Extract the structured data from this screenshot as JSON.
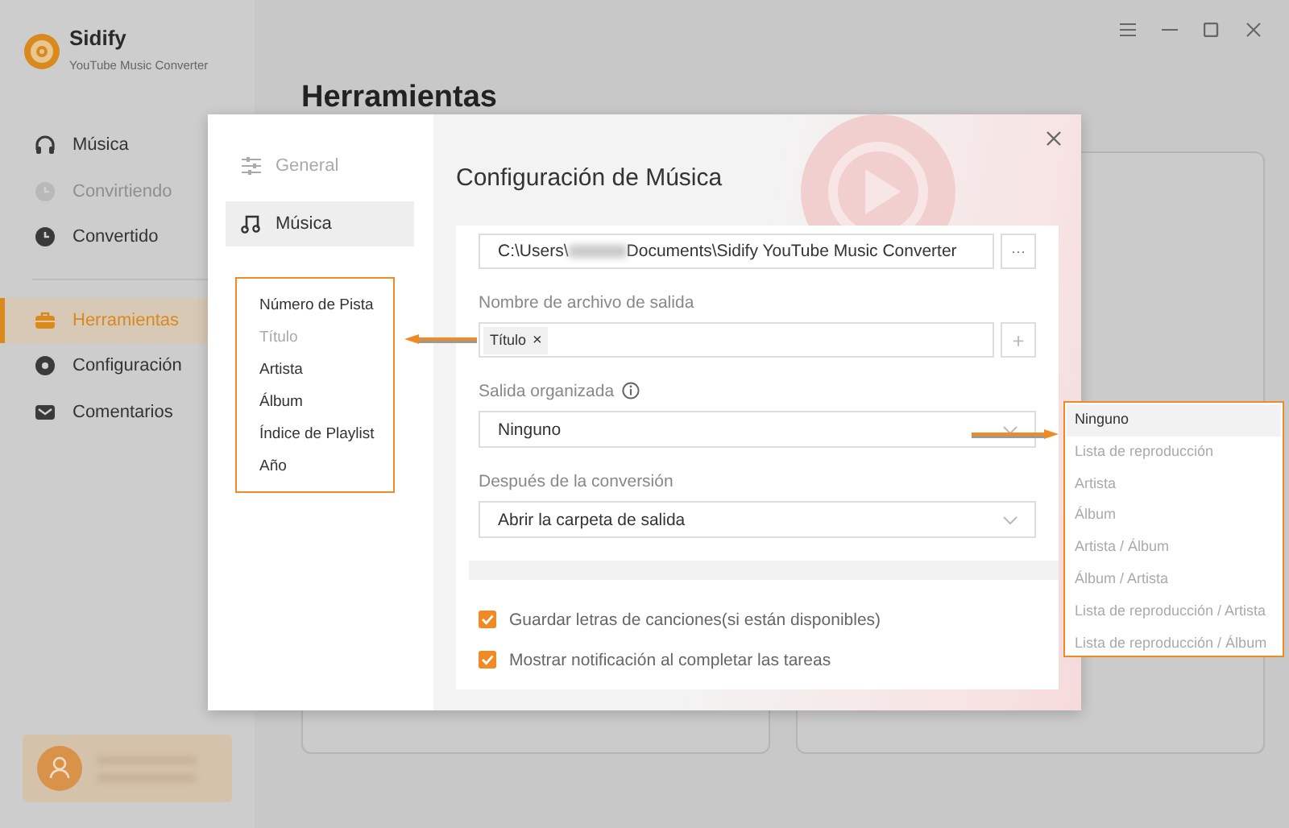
{
  "app": {
    "name": "Sidify",
    "subtitle": "YouTube Music Converter"
  },
  "sidebar": {
    "items": [
      {
        "label": "Música",
        "selected": false,
        "disabled": false
      },
      {
        "label": "Convirtiendo",
        "selected": false,
        "disabled": true
      },
      {
        "label": "Convertido",
        "selected": false,
        "disabled": false
      },
      {
        "label": "Herramientas",
        "selected": true,
        "disabled": false
      },
      {
        "label": "Configuración",
        "selected": false,
        "disabled": false
      },
      {
        "label": "Comentarios",
        "selected": false,
        "disabled": false
      }
    ]
  },
  "page": {
    "title": "Herramientas"
  },
  "dialog": {
    "nav": [
      {
        "label": "General",
        "selected": false
      },
      {
        "label": "Música",
        "selected": true
      }
    ],
    "title": "Configuración de Música",
    "output_folder": {
      "prefix": "C:\\Users\\",
      "suffix": "Documents\\Sidify YouTube Music Converter",
      "browse": "···"
    },
    "filename": {
      "label": "Nombre de archivo de salida",
      "tags": [
        {
          "label": "Título",
          "remove": "×"
        }
      ],
      "add": "+"
    },
    "organized": {
      "label": "Salida organizada",
      "value": "Ninguno"
    },
    "after": {
      "label": "Después de la conversión",
      "value": "Abrir la carpeta de salida"
    },
    "options": [
      {
        "label": "Guardar letras de canciones(si están disponibles)",
        "checked": true
      },
      {
        "label": "Mostrar notificación al completar las tareas",
        "checked": true
      }
    ]
  },
  "callouts": {
    "tag_options": [
      {
        "label": "Número de Pista",
        "disabled": false
      },
      {
        "label": "Título",
        "disabled": true
      },
      {
        "label": "Artista",
        "disabled": false
      },
      {
        "label": "Álbum",
        "disabled": false
      },
      {
        "label": "Índice de Playlist",
        "disabled": false
      },
      {
        "label": "Año",
        "disabled": false
      }
    ],
    "organize_options": [
      {
        "label": "Ninguno",
        "selected": true
      },
      {
        "label": "Lista de reproducción",
        "selected": false
      },
      {
        "label": "Artista",
        "selected": false
      },
      {
        "label": "Álbum",
        "selected": false
      },
      {
        "label": "Artista / Álbum",
        "selected": false
      },
      {
        "label": "Álbum / Artista",
        "selected": false
      },
      {
        "label": "Lista de reproducción / Artista",
        "selected": false
      },
      {
        "label": "Lista de reproducción / Álbum",
        "selected": false
      }
    ]
  }
}
